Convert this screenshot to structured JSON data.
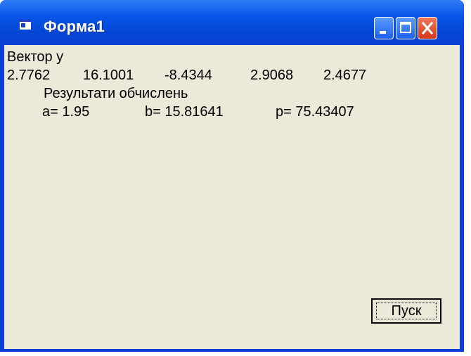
{
  "window": {
    "title": "Форма1"
  },
  "vector": {
    "label": "Вектор y",
    "values": [
      "2.7762",
      "16.1001",
      "-8.4344",
      "2.9068",
      "2.4677"
    ]
  },
  "results": {
    "heading": "Результати обчислень",
    "a": "a= 1.95",
    "b": "b= 15.81641",
    "p": "p= 75.43407"
  },
  "button": {
    "label": "Пуск"
  }
}
